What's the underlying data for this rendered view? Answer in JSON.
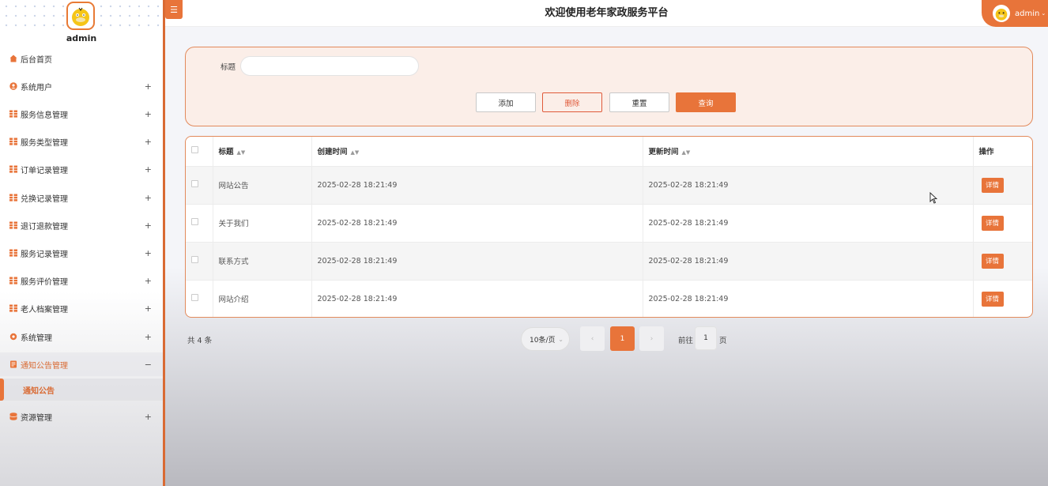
{
  "colors": {
    "accent": "#e8743a",
    "panel_bg": "#fbeee8",
    "danger": "#e05a3a"
  },
  "header": {
    "title": "欢迎使用老年家政服务平台",
    "user": "admin"
  },
  "sidebar": {
    "username": "admin",
    "items": [
      {
        "label": "后台首页",
        "icon": "home-icon",
        "expand": ""
      },
      {
        "label": "系统用户",
        "icon": "user-icon",
        "expand": "+"
      },
      {
        "label": "服务信息管理",
        "icon": "grid-icon",
        "expand": "+"
      },
      {
        "label": "服务类型管理",
        "icon": "grid-icon",
        "expand": "+"
      },
      {
        "label": "订单记录管理",
        "icon": "grid-icon",
        "expand": "+"
      },
      {
        "label": "兑换记录管理",
        "icon": "grid-icon",
        "expand": "+"
      },
      {
        "label": "退订退款管理",
        "icon": "grid-icon",
        "expand": "+"
      },
      {
        "label": "服务记录管理",
        "icon": "grid-icon",
        "expand": "+"
      },
      {
        "label": "服务评价管理",
        "icon": "grid-icon",
        "expand": "+"
      },
      {
        "label": "老人档案管理",
        "icon": "grid-icon",
        "expand": "+"
      },
      {
        "label": "系统管理",
        "icon": "gear-icon",
        "expand": "+"
      },
      {
        "label": "通知公告管理",
        "icon": "document-icon",
        "expand": "−"
      },
      {
        "label": "资源管理",
        "icon": "database-icon",
        "expand": "+"
      }
    ],
    "sub_item": "通知公告"
  },
  "search": {
    "label": "标题",
    "value": "",
    "placeholder": ""
  },
  "buttons": {
    "add": "添加",
    "delete": "删除",
    "reset": "重置",
    "query": "查询"
  },
  "table": {
    "columns": [
      "标题",
      "创建时间",
      "更新时间",
      "操作"
    ],
    "rows": [
      {
        "title": "网站公告",
        "created": "2025-02-28 18:21:49",
        "updated": "2025-02-28 18:21:49",
        "action": "详情"
      },
      {
        "title": "关于我们",
        "created": "2025-02-28 18:21:49",
        "updated": "2025-02-28 18:21:49",
        "action": "详情"
      },
      {
        "title": "联系方式",
        "created": "2025-02-28 18:21:49",
        "updated": "2025-02-28 18:21:49",
        "action": "详情"
      },
      {
        "title": "网站介绍",
        "created": "2025-02-28 18:21:49",
        "updated": "2025-02-28 18:21:49",
        "action": "详情"
      }
    ]
  },
  "pagination": {
    "total": "共 4 条",
    "page_size": "10条/页",
    "prev": "‹",
    "current": "1",
    "next": "›",
    "goto_label": "前往",
    "goto_value": "1",
    "suffix": "页"
  }
}
